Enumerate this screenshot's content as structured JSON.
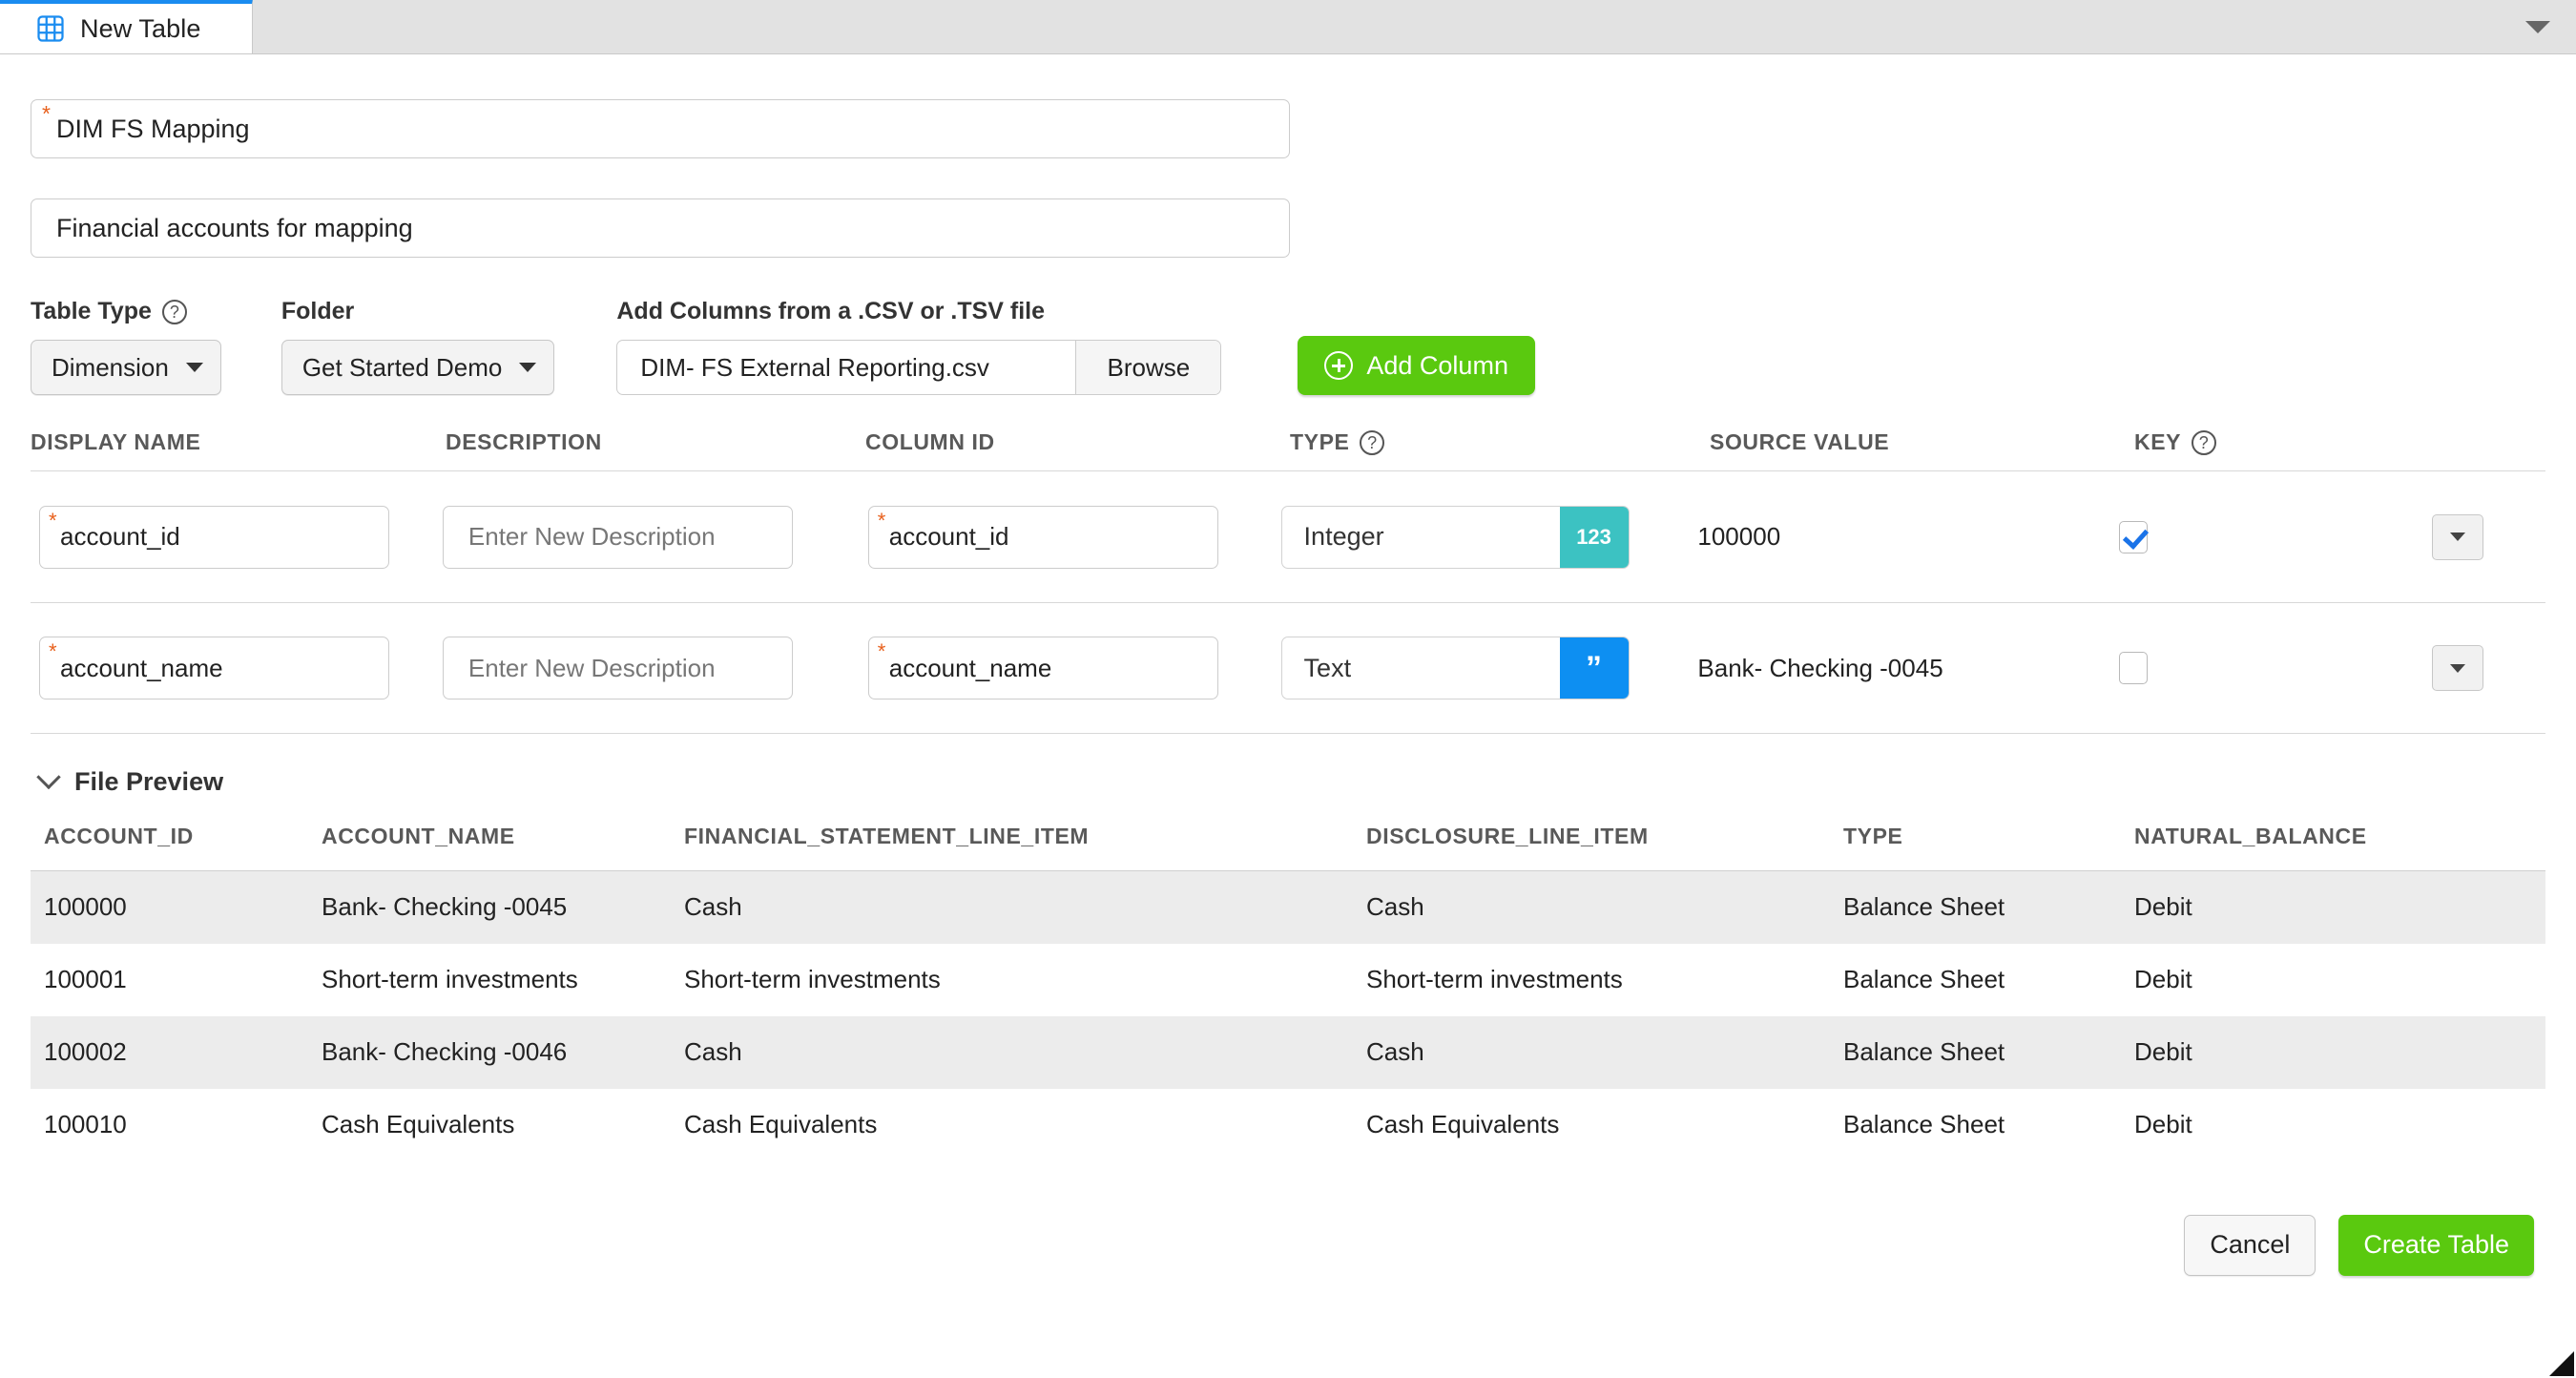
{
  "tab": {
    "label": "New Table",
    "icon": "table-grid-icon",
    "accent_color": "#1a8cf0",
    "overflow_icon": "chevron-down-icon"
  },
  "form": {
    "name_value": "DIM FS Mapping",
    "name_required_marker": "*",
    "description_value": "Financial accounts for mapping"
  },
  "options": {
    "table_type": {
      "label": "Table Type",
      "value": "Dimension",
      "help_icon": "question-mark-icon"
    },
    "folder": {
      "label": "Folder",
      "value": "Get Started Demo"
    },
    "csv": {
      "label": "Add Columns from a .CSV or .TSV file",
      "file_value": "DIM- FS External Reporting.csv",
      "browse_label": "Browse"
    },
    "add_column_label": "Add Column",
    "add_column_icon": "plus-circle-icon",
    "add_column_color": "#5ac90f"
  },
  "columns_table": {
    "headers": {
      "display_name": "DISPLAY NAME",
      "description": "DESCRIPTION",
      "column_id": "COLUMN ID",
      "type": "TYPE",
      "source_value": "SOURCE VALUE",
      "key": "KEY"
    },
    "description_placeholder": "Enter New Description",
    "rows": [
      {
        "display_name": "account_id",
        "description": "",
        "column_id": "account_id",
        "type": "Integer",
        "type_badge": "123",
        "type_badge_color": "#3cc2c2",
        "source_value": "100000",
        "key_checked": true,
        "required_marker": "*",
        "menu_icon": "caret-down-icon"
      },
      {
        "display_name": "account_name",
        "description": "",
        "column_id": "account_name",
        "type": "Text",
        "type_badge": "”",
        "type_badge_color": "#0d8ff2",
        "source_value": "Bank- Checking -0045",
        "key_checked": false,
        "required_marker": "*",
        "menu_icon": "caret-down-icon"
      }
    ]
  },
  "file_preview": {
    "title": "File Preview",
    "toggle_icon": "chevron-down-icon",
    "headers": [
      "ACCOUNT_ID",
      "ACCOUNT_NAME",
      "FINANCIAL_STATEMENT_LINE_ITEM",
      "DISCLOSURE_LINE_ITEM",
      "TYPE",
      "NATURAL_BALANCE"
    ],
    "rows": [
      [
        "100000",
        "Bank- Checking -0045",
        "Cash",
        "Cash",
        "Balance Sheet",
        "Debit"
      ],
      [
        "100001",
        "Short-term investments",
        "Short-term investments",
        "Short-term investments",
        "Balance Sheet",
        "Debit"
      ],
      [
        "100002",
        "Bank- Checking -0046",
        "Cash",
        "Cash",
        "Balance Sheet",
        "Debit"
      ],
      [
        "100010",
        "Cash Equivalents",
        "Cash Equivalents",
        "Cash Equivalents",
        "Balance Sheet",
        "Debit"
      ]
    ]
  },
  "footer": {
    "cancel_label": "Cancel",
    "create_label": "Create Table",
    "create_color": "#5ac90f"
  }
}
